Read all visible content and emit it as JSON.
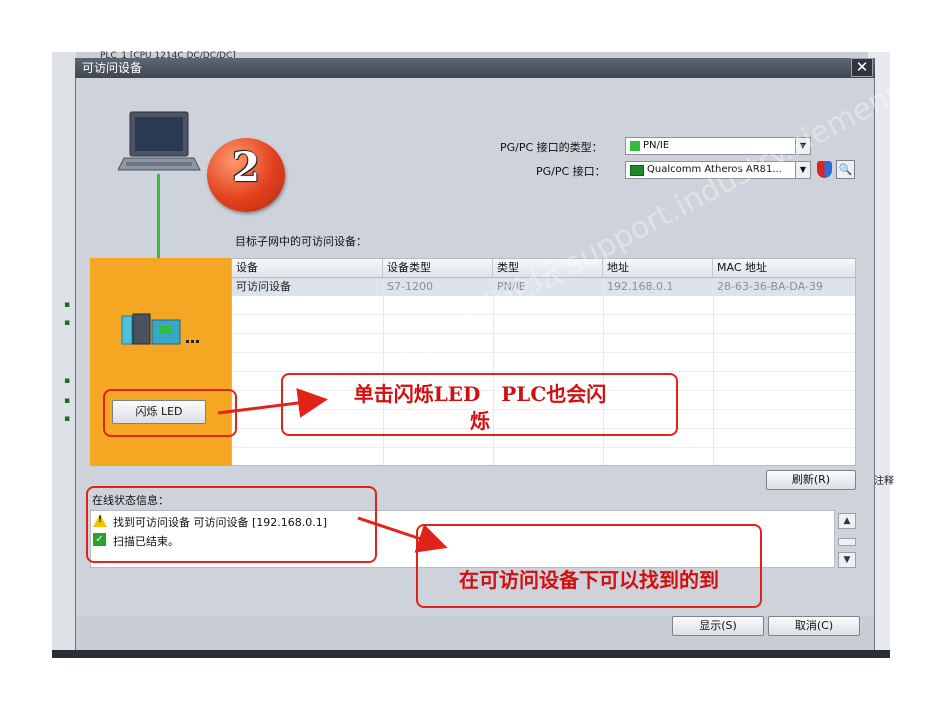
{
  "background": {
    "title_fragment": "PLC_1 [CPU 1214C DC/DC/DC]",
    "right_fragment": "注释"
  },
  "dialog": {
    "title": "可访问设备",
    "close_label": "✕"
  },
  "step": {
    "number": "2"
  },
  "interface_type": {
    "label": "PG/PC 接口的类型：",
    "value": "PN/IE"
  },
  "interface": {
    "label": "PG/PC 接口：",
    "value": "Qualcomm Atheros AR81..."
  },
  "subnet_label": "目标子网中的可访问设备：",
  "table": {
    "columns": [
      "设备",
      "设备类型",
      "类型",
      "地址",
      "MAC 地址"
    ],
    "rows": [
      {
        "device": "可访问设备",
        "device_type": "S7-1200",
        "type": "PN/IE",
        "address": "192.168.0.1",
        "mac": "28-63-36-BA-DA-39"
      }
    ]
  },
  "flash_led_label": "闪烁 LED",
  "refresh_label": "刷新(R)",
  "status": {
    "label": "在线状态信息：",
    "messages": [
      {
        "icon": "warning-icon",
        "text": "找到可访问设备 可访问设备 [192.168.0.1]"
      },
      {
        "icon": "check-icon",
        "text": "扫描已结束。"
      }
    ]
  },
  "footer": {
    "show_label": "显示(S)",
    "cancel_label": "取消(C)"
  },
  "annotations": {
    "flash_note_line1": "单击闪烁LED   PLC也会闪",
    "flash_note_line2": "烁",
    "found_note": "在可访问设备下可以找到的到"
  },
  "watermark": "西门子工业  技术论坛 support.industry.siemens.com",
  "colors": {
    "orange": "#f5a623",
    "annotation_red": "#e2231a",
    "link_green": "#2fbf3a"
  }
}
